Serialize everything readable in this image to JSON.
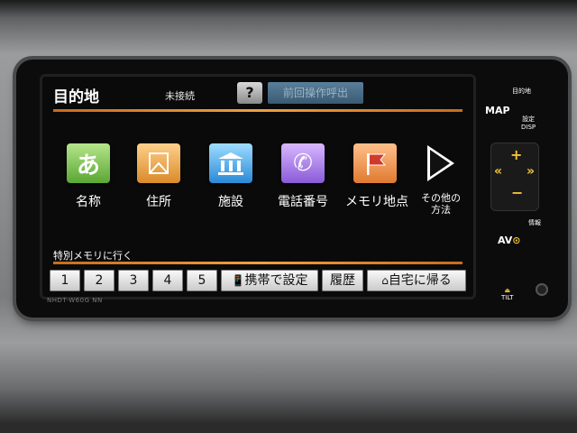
{
  "screen": {
    "title": "目的地",
    "connection_status": "未接続",
    "help_label": "?",
    "recall_button": "前回操作呼出"
  },
  "categories": [
    {
      "label": "名称",
      "icon": "hiragana-a-icon",
      "glyph": "あ"
    },
    {
      "label": "住所",
      "icon": "address-map-icon",
      "glyph": ""
    },
    {
      "label": "施設",
      "icon": "building-icon",
      "glyph": ""
    },
    {
      "label": "電話番号",
      "icon": "phone-icon",
      "glyph": "✆"
    },
    {
      "label": "メモリ地点",
      "icon": "flag-icon",
      "glyph": ""
    }
  ],
  "more": {
    "line1": "その他の",
    "line2": "方法",
    "icon": "play-arrow-icon"
  },
  "memory_label": "特別メモリに行く",
  "bottom_buttons": {
    "numbers": [
      "1",
      "2",
      "3",
      "4",
      "5"
    ],
    "phone_setup": "携帯で設定",
    "history": "履歴",
    "go_home": "自宅に帰る"
  },
  "model_text": "NHDT-W60G  NN",
  "hardware": {
    "dest_key": "目的地",
    "map_key": "MAP",
    "disp_key_1": "設定",
    "disp_key_2": "DISP",
    "plus": "+",
    "minus": "−",
    "seek_back": "«",
    "seek_fwd": "»",
    "info_key": "情報",
    "av_key": "AV",
    "tilt": "TILT"
  },
  "colors": {
    "accent_orange": "#e8962e",
    "screen_bg": "#0a0a0a",
    "button_face": "#f2f2f2"
  }
}
